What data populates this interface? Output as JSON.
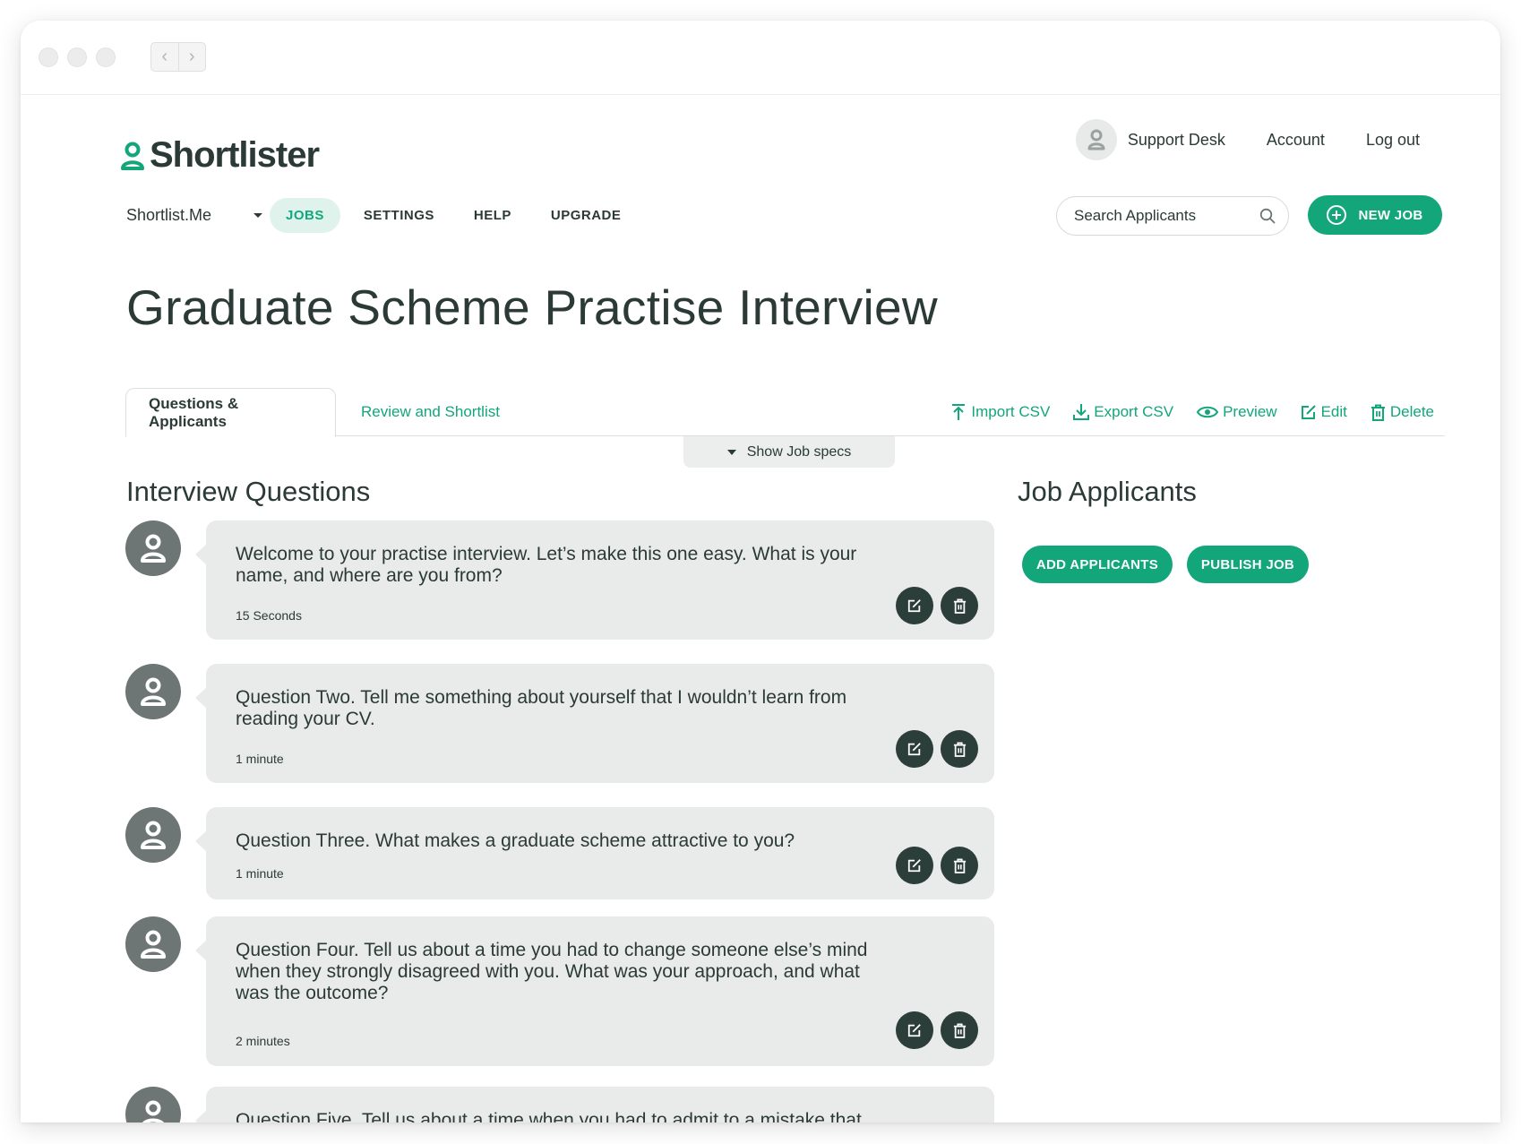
{
  "browser": {
    "back": "‹",
    "forward": "›"
  },
  "header": {
    "logo_text": "Shortlister",
    "support_label": "Support Desk",
    "account_label": "Account",
    "logout_label": "Log out"
  },
  "nav": {
    "org_name": "Shortlist.Me",
    "items": [
      {
        "label": "JOBS",
        "active": true
      },
      {
        "label": "SETTINGS",
        "active": false
      },
      {
        "label": "HELP",
        "active": false
      },
      {
        "label": "UPGRADE",
        "active": false
      }
    ]
  },
  "search": {
    "placeholder": "Search Applicants"
  },
  "new_job_label": "NEW JOB",
  "page_title": "Graduate Scheme Practise Interview",
  "tabs": [
    {
      "label": "Questions & Applicants",
      "active": true
    },
    {
      "label": "Review and Shortlist",
      "active": false
    }
  ],
  "actions": {
    "import": "Import CSV",
    "export": "Export CSV",
    "preview": "Preview",
    "edit": "Edit",
    "delete": "Delete"
  },
  "show_specs_label": "Show Job specs",
  "questions_heading": "Interview Questions",
  "questions": [
    {
      "text": "Welcome to your practise interview. Let’s make this one easy. What is your name, and where are you from?",
      "duration": "15 Seconds"
    },
    {
      "text": "Question Two. Tell me something about yourself that I wouldn’t learn from reading your CV.",
      "duration": "1 minute"
    },
    {
      "text": "Question Three. What makes a graduate scheme attractive to you?",
      "duration": "1 minute"
    },
    {
      "text": "Question Four. Tell us about a time you had to change someone else’s mind when they strongly disagreed with you. What was your approach, and what was the outcome?",
      "duration": "2 minutes"
    },
    {
      "text": "Question Five. Tell us about a time when you had to admit to a mistake that affected others. How did you handle it?",
      "duration": ""
    }
  ],
  "applicants_heading": "Job Applicants",
  "add_applicants_label": "ADD APPLICANTS",
  "publish_job_label": "PUBLISH JOB",
  "colors": {
    "brand": "#12a67a",
    "brand_light": "#dff3ec",
    "text": "#2b3a37",
    "bubble": "#e9ebea",
    "avatar": "#6d7674",
    "icon_button": "#2c3e3a"
  }
}
